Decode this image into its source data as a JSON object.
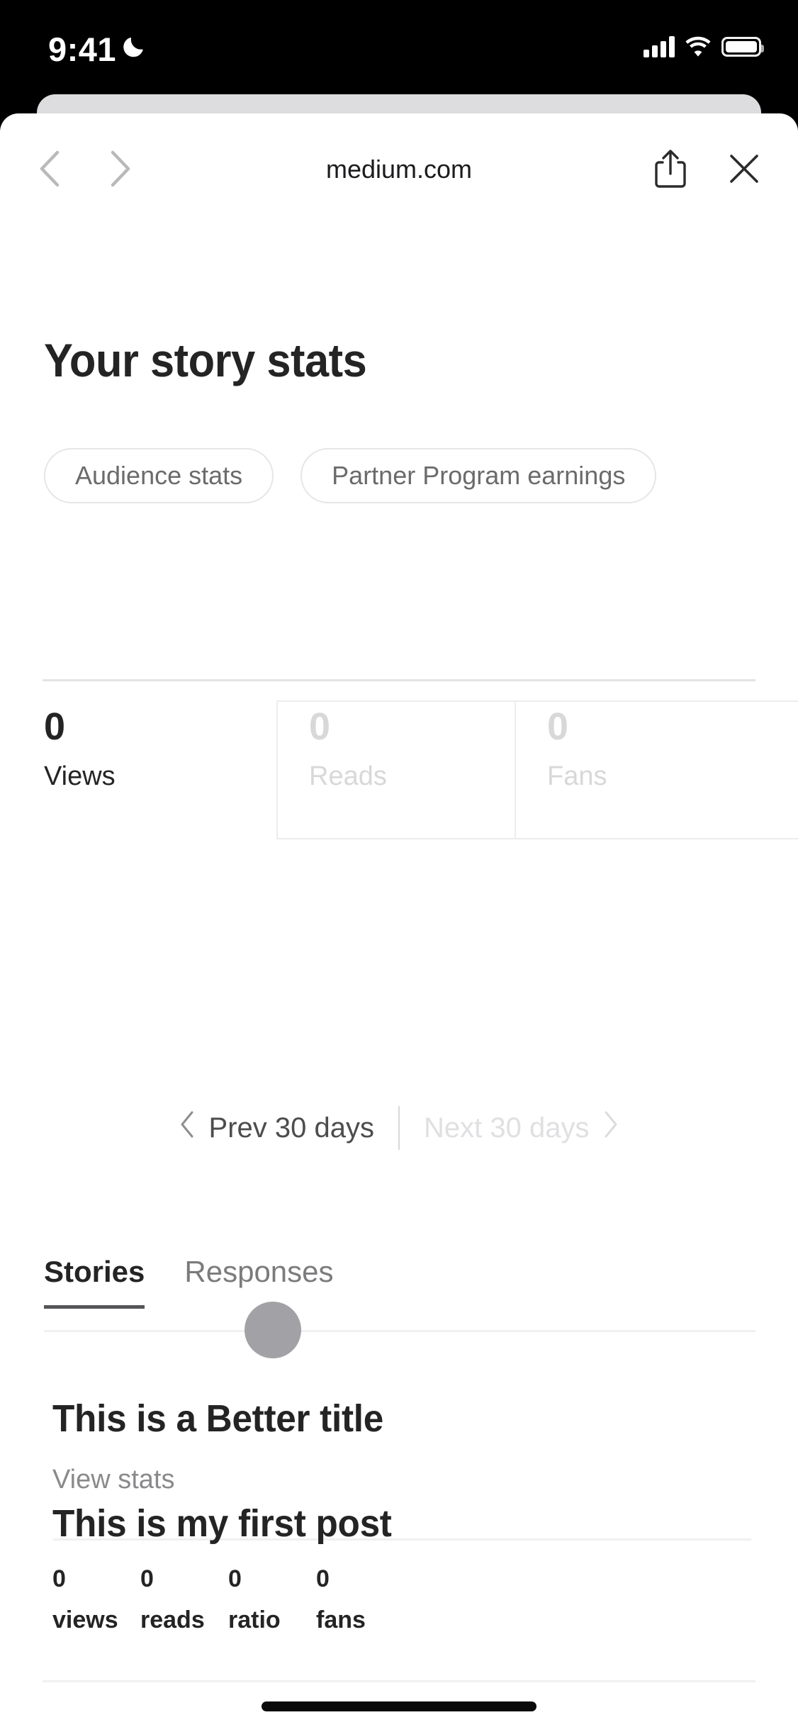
{
  "status_bar": {
    "time": "9:41",
    "dnd_icon": "moon-icon",
    "signal_icon": "cellular-signal-icon",
    "wifi_icon": "wifi-icon",
    "battery_icon": "battery-icon"
  },
  "browser": {
    "domain": "medium.com",
    "back_icon": "chevron-left-icon",
    "forward_icon": "chevron-right-icon",
    "share_icon": "share-icon",
    "close_icon": "close-icon"
  },
  "page": {
    "title": "Your story stats",
    "filters": [
      {
        "label": "Audience stats"
      },
      {
        "label": "Partner Program earnings"
      }
    ],
    "summary_stats": [
      {
        "value": "0",
        "label": "Views",
        "state": "active"
      },
      {
        "value": "0",
        "label": "Reads",
        "state": "dim"
      },
      {
        "value": "0",
        "label": "Fans",
        "state": "dim"
      }
    ],
    "pagination": {
      "prev_label": "Prev 30 days",
      "next_label": "Next 30 days",
      "prev_icon": "chevron-left-icon",
      "next_icon": "chevron-right-icon",
      "next_state": "disabled"
    },
    "tabs": [
      {
        "label": "Stories",
        "state": "active"
      },
      {
        "label": "Responses",
        "state": "inactive"
      }
    ],
    "loading_indicator": "loading-dot",
    "stories": [
      {
        "title": "This is a Better title",
        "link_label": "View stats",
        "metrics": [
          {
            "value": "0",
            "label": "views"
          },
          {
            "value": "0",
            "label": "reads"
          },
          {
            "value": "0",
            "label": "ratio"
          },
          {
            "value": "0",
            "label": "fans"
          }
        ]
      },
      {
        "title": "This is my first post"
      }
    ]
  },
  "colors": {
    "text_primary": "#242424",
    "text_secondary": "#6b6b6b",
    "text_disabled": "#d8d8da",
    "border": "#e6e6e6",
    "dot": "#a2a2a6"
  }
}
